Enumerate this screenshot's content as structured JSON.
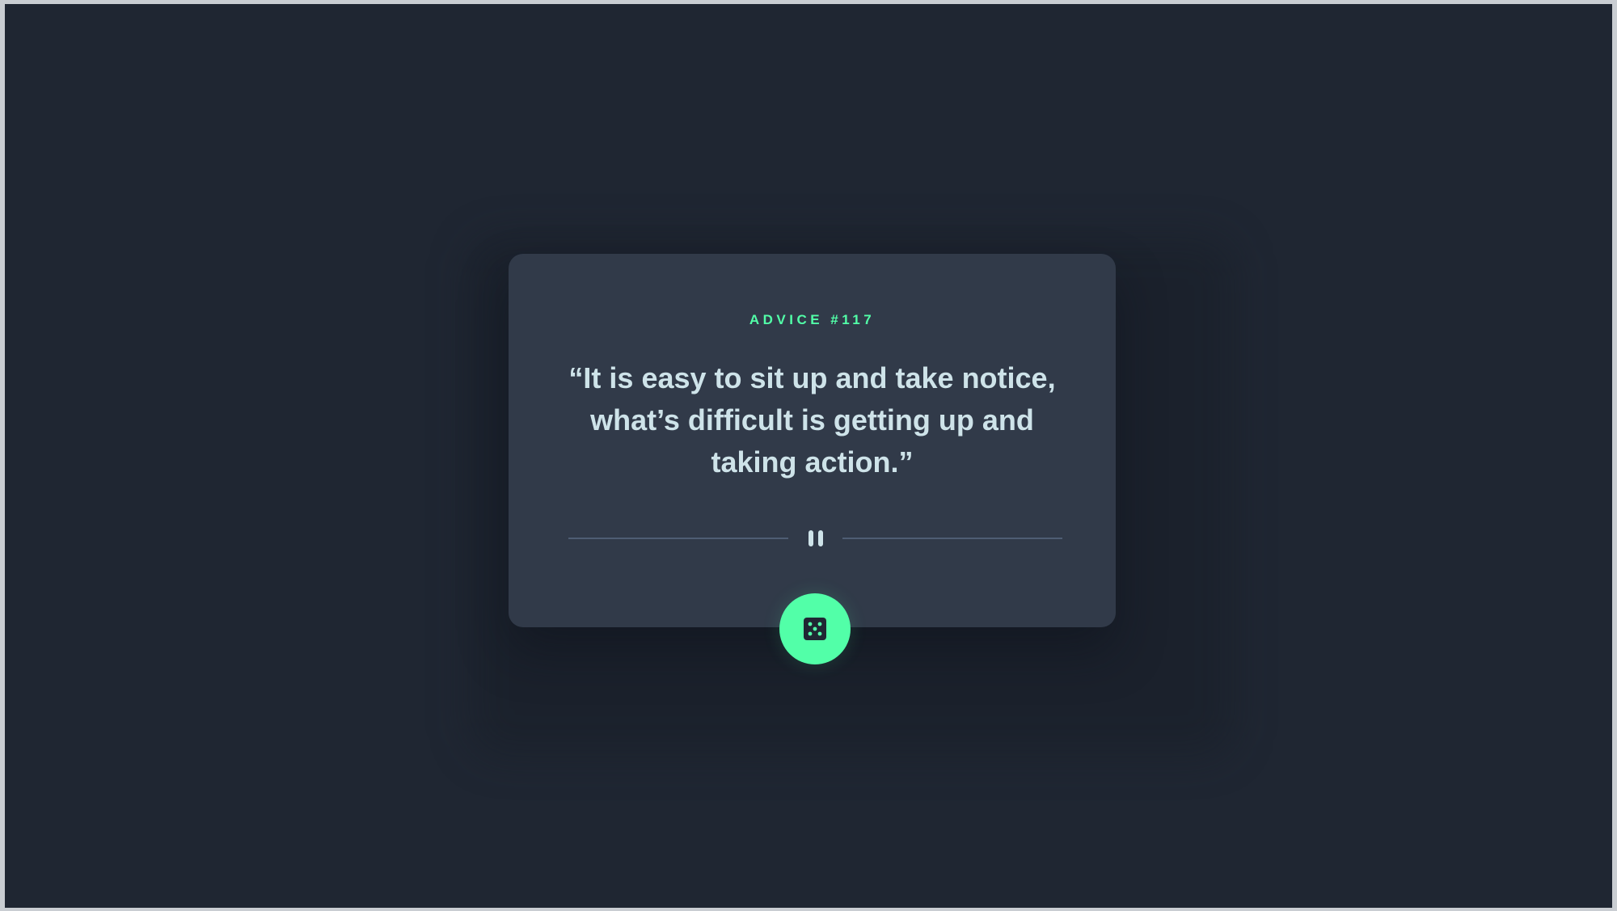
{
  "advice": {
    "number_label": "ADVICE #117",
    "quote": "“It is easy to sit up and take notice, what’s difficult is getting up and taking action.”"
  },
  "icons": {
    "divider": "pause-icon",
    "generate": "dice-icon"
  },
  "colors": {
    "background": "#1f2632",
    "card": "#313a49",
    "accent": "#52ffa8",
    "quote_text": "#cee3e9",
    "divider": "#4e5d73"
  }
}
